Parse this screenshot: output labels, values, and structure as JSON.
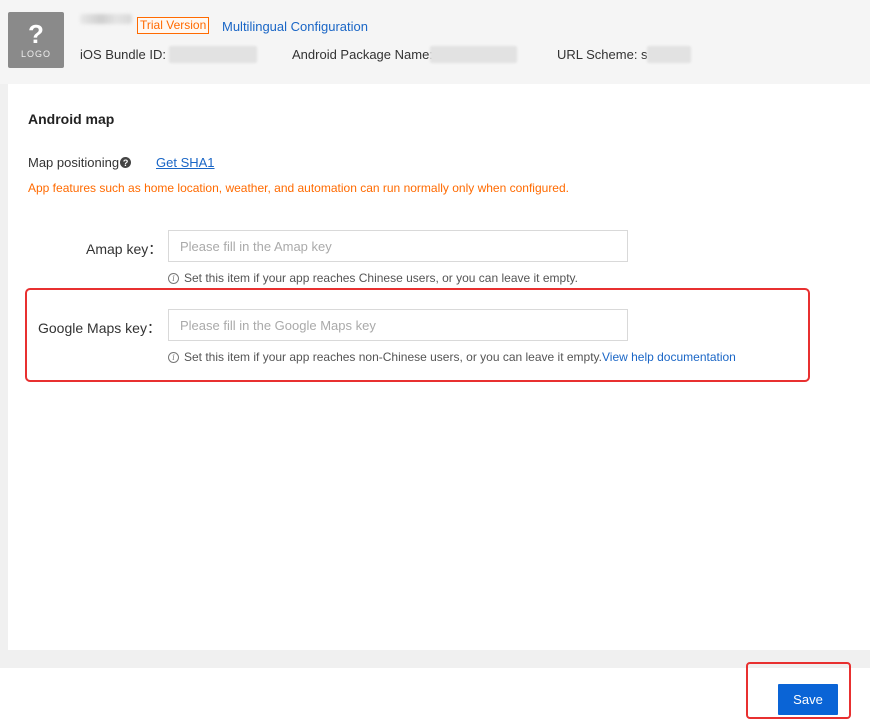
{
  "header": {
    "logo_symbol": "?",
    "logo_text": "LOGO",
    "trial_badge": "Trial Version",
    "multilingual_link": "Multilingual Configuration",
    "ios_bundle_label": "iOS Bundle ID:",
    "android_package_label": "Android Package Name:",
    "url_scheme_label": "URL Scheme: s"
  },
  "main": {
    "section_title": "Android map",
    "map_positioning_label": "Map positioning",
    "help_icon_glyph": "?",
    "get_sha1_link": "Get SHA1",
    "warning": "App features such as home location, weather, and automation can run normally only when configured.",
    "amap": {
      "label": "Amap key：",
      "placeholder": "Please fill in the Amap key",
      "value": "",
      "hint": "Set this item if your app reaches Chinese users, or you can leave it empty."
    },
    "google": {
      "label": "Google Maps key：",
      "placeholder": "Please fill in the Google Maps key",
      "value": "",
      "hint": "Set this item if your app reaches non-Chinese users, or you can leave it empty.",
      "help_link": "View help documentation"
    }
  },
  "footer": {
    "save_label": "Save"
  },
  "colors": {
    "accent_blue": "#0a64d6",
    "link_blue": "#1a66c6",
    "warning_orange": "#ff6a00",
    "highlight_red": "#e83030"
  },
  "icons": {
    "info": "info-icon",
    "help": "help-icon"
  }
}
